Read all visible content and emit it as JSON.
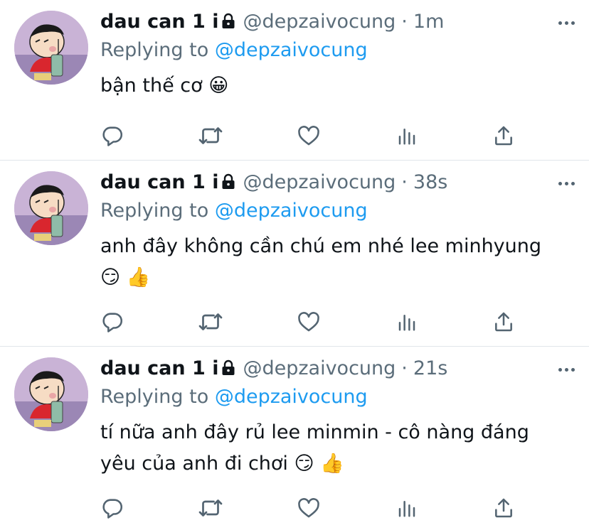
{
  "colors": {
    "text": "#0f1419",
    "secondary": "#5b6d7a",
    "mention": "#1d9bf0",
    "icon": "#536471",
    "divider": "#e1e6ea"
  },
  "tweets": [
    {
      "display_name": "dau can 1 i",
      "handle": "@depzaivocung",
      "separator": "·",
      "time": "1m",
      "replying_prefix": "Replying to",
      "replying_to": "@depzaivocung",
      "text": "bận thế cơ 😀"
    },
    {
      "display_name": "dau can 1 i",
      "handle": "@depzaivocung",
      "separator": "·",
      "time": "38s",
      "replying_prefix": "Replying to",
      "replying_to": "@depzaivocung",
      "text": "anh đây không cần chú em nhé lee minhyung\n😏 👍"
    },
    {
      "display_name": "dau can 1 i",
      "handle": "@depzaivocung",
      "separator": "·",
      "time": "21s",
      "replying_prefix": "Replying to",
      "replying_to": "@depzaivocung",
      "text": "tí nữa anh đây rủ lee minmin - cô nàng đáng\nyêu của anh đi chơi 😏 👍"
    }
  ],
  "icons": {
    "verified_lock": "lock-icon",
    "more": "more-icon",
    "reply": "reply-icon",
    "retweet": "retweet-icon",
    "like": "heart-icon",
    "analytics": "analytics-icon",
    "share": "share-icon"
  }
}
